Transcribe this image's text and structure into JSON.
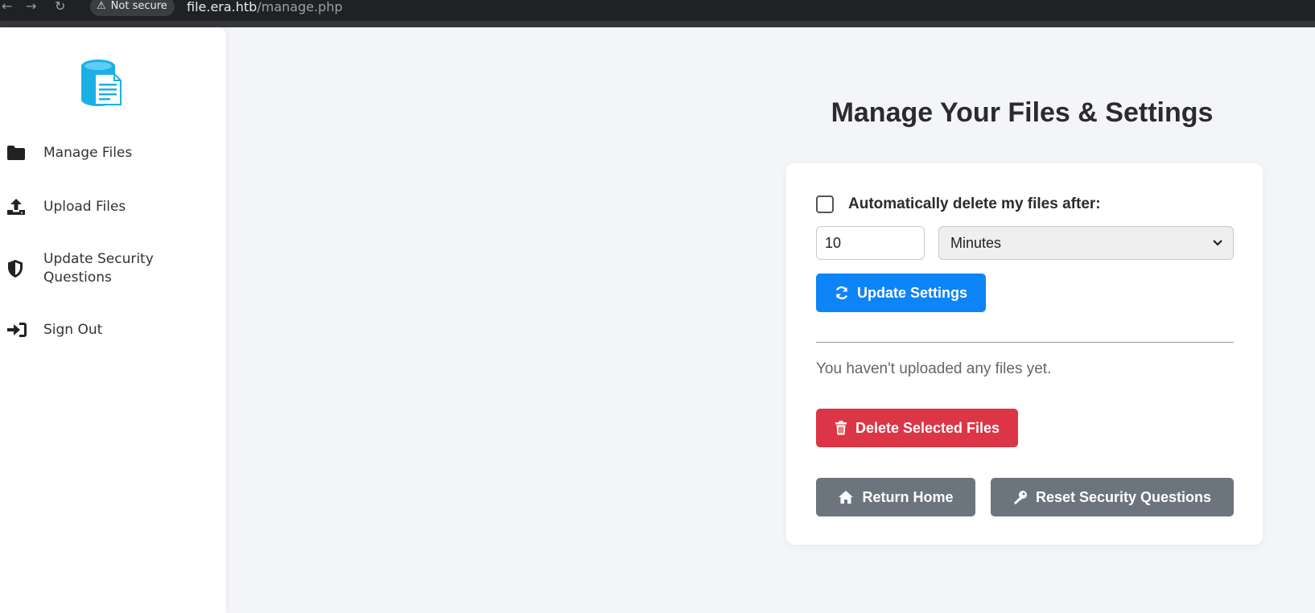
{
  "browser": {
    "security_chip": "Not secure",
    "url_host": "file.era.htb",
    "url_path": "/manage.php"
  },
  "sidebar": {
    "logo_icon": "file-database-logo",
    "items": [
      {
        "label": "Manage Files",
        "icon": "folder-icon"
      },
      {
        "label": "Upload Files",
        "icon": "upload-icon"
      },
      {
        "label": "Update Security Questions",
        "icon": "shield-icon"
      },
      {
        "label": "Sign Out",
        "icon": "sign-out-icon"
      }
    ]
  },
  "main": {
    "title": "Manage Your Files & Settings",
    "auto_delete": {
      "label": "Automatically delete my files after:",
      "checked": false,
      "amount": "10",
      "unit": "Minutes"
    },
    "update_button": "Update Settings",
    "empty_message": "You haven't uploaded any files yet.",
    "delete_button": "Delete Selected Files",
    "return_button": "Return Home",
    "reset_button": "Reset Security Questions"
  },
  "colors": {
    "primary": "#0d84f8",
    "danger": "#dc3545",
    "secondary": "#6c757d",
    "logo": "#1ab0e6"
  }
}
